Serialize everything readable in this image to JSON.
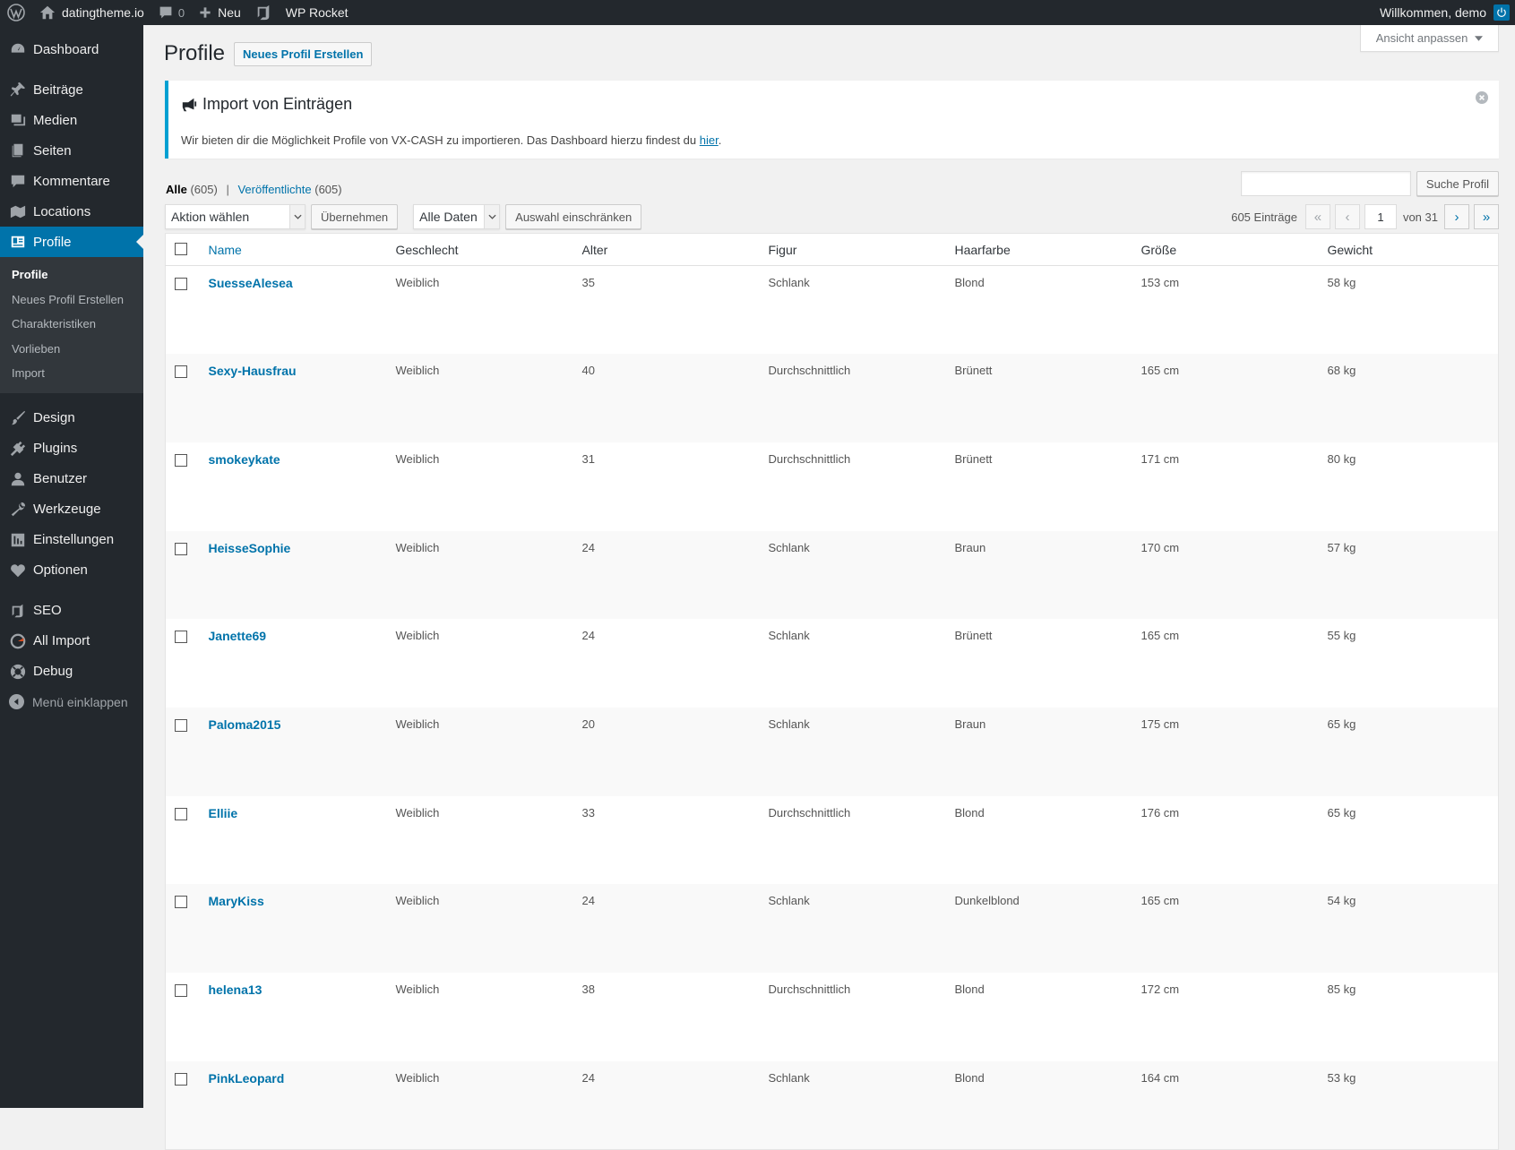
{
  "adminbar": {
    "site_name": "datingtheme.io",
    "comments_count": "0",
    "new_label": "Neu",
    "wp_rocket": "WP Rocket",
    "welcome": "Willkommen, demo"
  },
  "sidebar": {
    "items": [
      {
        "label": "Dashboard",
        "icon": "dashboard-icon"
      },
      {
        "label": "Beiträge",
        "icon": "pin-icon"
      },
      {
        "label": "Medien",
        "icon": "media-icon"
      },
      {
        "label": "Seiten",
        "icon": "pages-icon"
      },
      {
        "label": "Kommentare",
        "icon": "comment-icon"
      },
      {
        "label": "Locations",
        "icon": "map-icon"
      },
      {
        "label": "Profile",
        "icon": "id-card-icon"
      },
      {
        "label": "Design",
        "icon": "brush-icon"
      },
      {
        "label": "Plugins",
        "icon": "plug-icon"
      },
      {
        "label": "Benutzer",
        "icon": "user-icon"
      },
      {
        "label": "Werkzeuge",
        "icon": "wrench-icon"
      },
      {
        "label": "Einstellungen",
        "icon": "settings-icon"
      },
      {
        "label": "Optionen",
        "icon": "heart-icon"
      },
      {
        "label": "SEO",
        "icon": "yoast-icon"
      },
      {
        "label": "All Import",
        "icon": "import-icon"
      },
      {
        "label": "Debug",
        "icon": "lifebuoy-icon"
      }
    ],
    "submenu": [
      "Profile",
      "Neues Profil Erstellen",
      "Charakteristiken",
      "Vorlieben",
      "Import"
    ],
    "collapse": "Menü einklappen"
  },
  "screen_options": "Ansicht anpassen",
  "page": {
    "title": "Profile",
    "add_new": "Neues Profil Erstellen"
  },
  "notice": {
    "title": "Import von Einträgen",
    "text": "Wir bieten dir die Möglichkeit Profile von VX-CASH zu importieren. Das Dashboard hierzu findest du ",
    "link": "hier",
    "after": "."
  },
  "views": {
    "all": "Alle",
    "all_count": "(605)",
    "sep": "|",
    "published": "Veröffentlichte",
    "published_count": "(605)"
  },
  "search": {
    "button": "Suche Profil",
    "value": ""
  },
  "tablenav": {
    "bulk_action": "Aktion wählen",
    "apply": "Übernehmen",
    "dates": "Alle Daten",
    "filter": "Auswahl einschränken",
    "items": "605 Einträge",
    "first": "«",
    "prev": "‹",
    "current_page": "1",
    "of": "von 31",
    "next": "›",
    "last": "»"
  },
  "table": {
    "columns": [
      "Name",
      "Geschlecht",
      "Alter",
      "Figur",
      "Haarfarbe",
      "Größe",
      "Gewicht"
    ],
    "rows": [
      [
        "SuesseAlesea",
        "Weiblich",
        "35",
        "Schlank",
        "Blond",
        "153 cm",
        "58 kg"
      ],
      [
        "Sexy-Hausfrau",
        "Weiblich",
        "40",
        "Durchschnittlich",
        "Brünett",
        "165 cm",
        "68 kg"
      ],
      [
        "smokeykate",
        "Weiblich",
        "31",
        "Durchschnittlich",
        "Brünett",
        "171 cm",
        "80 kg"
      ],
      [
        "HeisseSophie",
        "Weiblich",
        "24",
        "Schlank",
        "Braun",
        "170 cm",
        "57 kg"
      ],
      [
        "Janette69",
        "Weiblich",
        "24",
        "Schlank",
        "Brünett",
        "165 cm",
        "55 kg"
      ],
      [
        "Paloma2015",
        "Weiblich",
        "20",
        "Schlank",
        "Braun",
        "175 cm",
        "65 kg"
      ],
      [
        "Elliie",
        "Weiblich",
        "33",
        "Durchschnittlich",
        "Blond",
        "176 cm",
        "65 kg"
      ],
      [
        "MaryKiss",
        "Weiblich",
        "24",
        "Schlank",
        "Dunkelblond",
        "165 cm",
        "54 kg"
      ],
      [
        "helena13",
        "Weiblich",
        "38",
        "Durchschnittlich",
        "Blond",
        "172 cm",
        "85 kg"
      ],
      [
        "PinkLeopard",
        "Weiblich",
        "24",
        "Schlank",
        "Blond",
        "164 cm",
        "53 kg"
      ]
    ]
  },
  "colors": {
    "accent": "#0073aa",
    "sidebar_bg": "#23282d",
    "notice_border": "#00a0d2"
  }
}
